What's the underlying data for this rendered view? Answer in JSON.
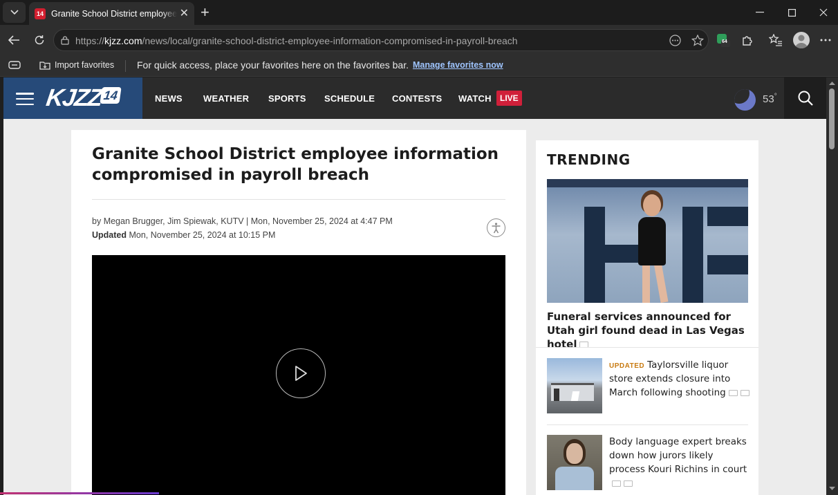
{
  "browser": {
    "tab_title": "Granite School District employee information compromised in payroll breach",
    "tab_favicon_text": "14",
    "url_prefix": "https://",
    "url_domain": "kjzz.com",
    "url_path": "/news/local/granite-school-district-employee-information-compromised-in-payroll-breach",
    "extension_badge": "64",
    "favorites_bar": {
      "import_label": "Import favorites",
      "message": "For quick access, place your favorites here on the favorites bar.",
      "manage_link": "Manage favorites now"
    }
  },
  "site": {
    "logo_text": "KJZZ",
    "logo_number": "14",
    "nav": [
      "NEWS",
      "WEATHER",
      "SPORTS",
      "SCHEDULE",
      "CONTESTS",
      "WATCH"
    ],
    "live_badge": "LIVE",
    "temperature": "53",
    "temperature_unit": "°",
    "colors": {
      "header": "#2b2b2b",
      "logo_bg": "#264a79",
      "live": "#d0203a",
      "updated": "#c87b12"
    }
  },
  "article": {
    "headline": "Granite School District employee information compromised in payroll breach",
    "byline_prefix": "by",
    "authors": "Megan Brugger, Jim Spiewak, KUTV",
    "published": "Mon, November 25, 2024 at 4:47 PM",
    "updated_label": "Updated",
    "updated": "Mon, November 25, 2024 at 10:15 PM"
  },
  "trending": {
    "title": "TRENDING",
    "featured_headline": "Funeral services announced for Utah girl found dead in Las Vegas hotel",
    "stories": [
      {
        "badge": "UPDATED",
        "headline": "Taylorsville liquor store extends closure into March following shooting"
      },
      {
        "badge": "",
        "headline": "Body language expert breaks down how jurors likely process Kouri Richins in court"
      }
    ]
  }
}
